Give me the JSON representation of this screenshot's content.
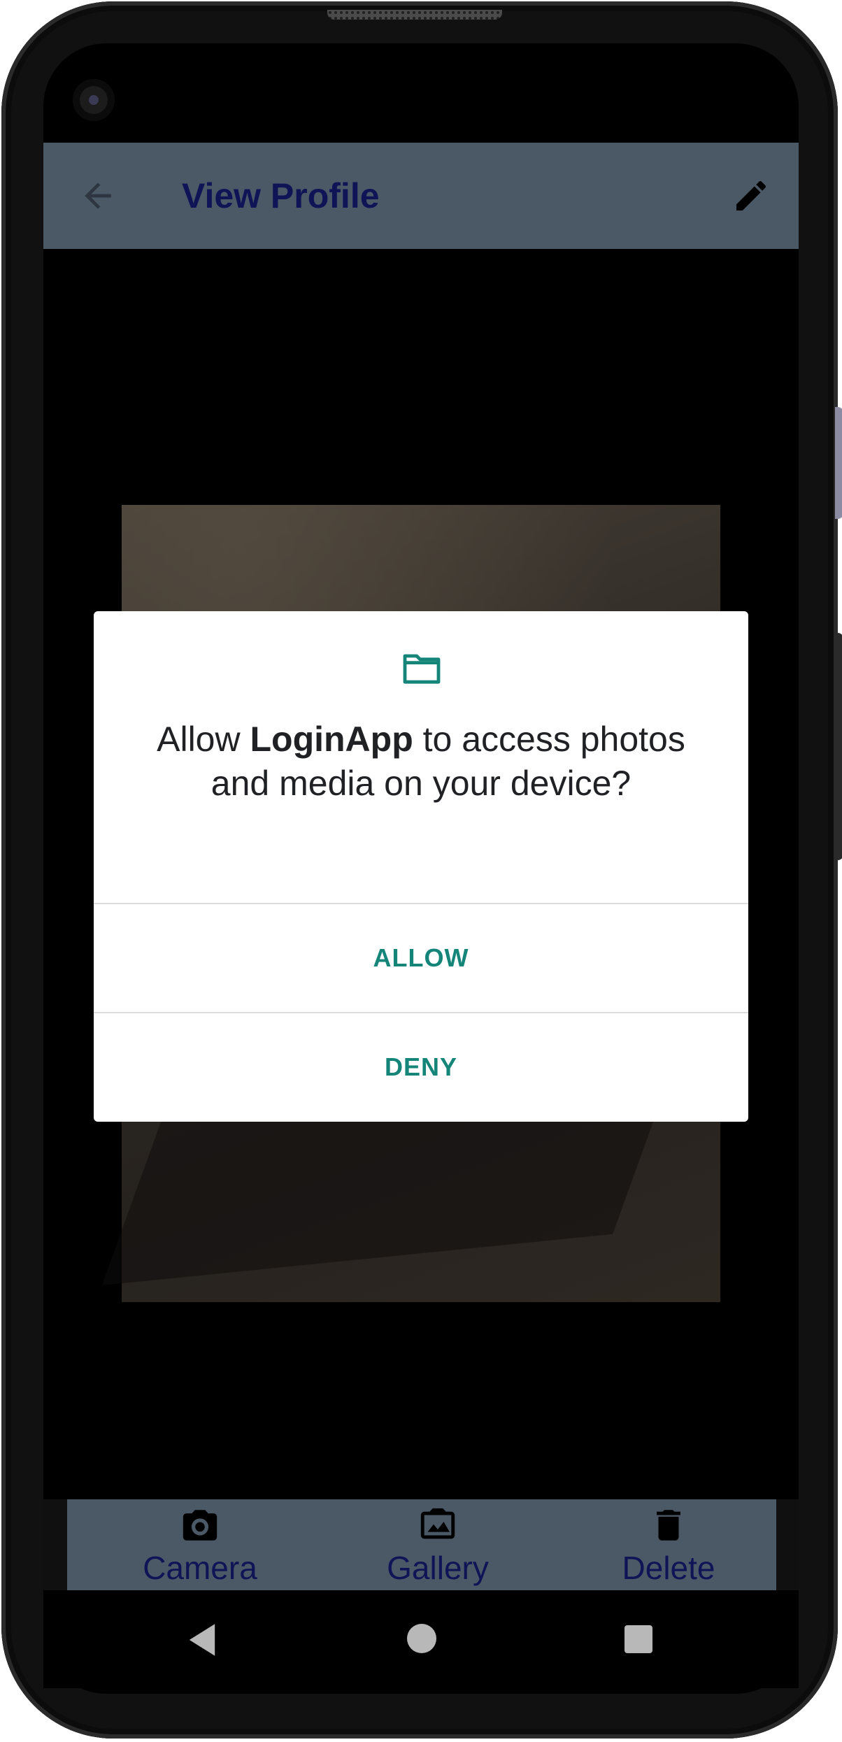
{
  "app_bar": {
    "title": "View Profile",
    "back_icon": "arrow-back-icon",
    "edit_icon": "pencil-icon",
    "background": "#4b5866",
    "title_color": "#0f1456"
  },
  "dialog": {
    "icon": "folder-icon",
    "prompt_prefix": "Allow ",
    "prompt_app": "LoginApp",
    "prompt_suffix": " to access photos and media on your device?",
    "allow_label": "ALLOW",
    "deny_label": "DENY",
    "accent": "#15857a"
  },
  "bottom_bar": {
    "items": [
      {
        "label": "Camera",
        "icon": "camera-icon"
      },
      {
        "label": "Gallery",
        "icon": "gallery-icon"
      },
      {
        "label": "Delete",
        "icon": "trash-icon"
      }
    ]
  },
  "nav_bar": {
    "back": "nav-back-icon",
    "home": "nav-home-icon",
    "recents": "nav-recents-icon"
  }
}
